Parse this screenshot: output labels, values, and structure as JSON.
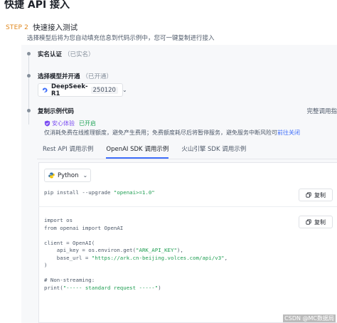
{
  "page": {
    "title": "快捷 API 接入"
  },
  "step": {
    "label": "STEP 2",
    "title": "快速接入测试",
    "desc": "选择模型后将为您自动填充信息到代码示例中，您可一键复制进行接入"
  },
  "rows": {
    "auth": {
      "label": "实名认证",
      "status": "（已实名）"
    },
    "model": {
      "label": "选择模型并开通",
      "status": "（已开通）"
    },
    "code": {
      "label": "复制示例代码"
    }
  },
  "model_select": {
    "name": "DeepSeek-R1",
    "version": "250120",
    "icon": "model-logo-icon"
  },
  "full_doc": "完整调用指",
  "safety": {
    "name": "安心体验",
    "status": "已开启",
    "notice": "仅消耗免费在线推理额度，避免产生费用；免费额度耗尽后将暂停服务，避免服务中断风险可",
    "link": "前往关闭"
  },
  "tabs": [
    {
      "label": "Rest API 调用示例"
    },
    {
      "label": "OpenAI SDK 调用示例"
    },
    {
      "label": "火山引擎 SDK 调用示例"
    }
  ],
  "lang_select": {
    "value": "Python"
  },
  "code": {
    "install": [
      "pip install --upgrade ",
      "\"openai>=1.0\""
    ],
    "l1": "import os",
    "l2": "from openai import OpenAI",
    "l3": "client = OpenAI(",
    "l4a": "    api_key = os.environ.get(",
    "l4b": "\"ARK_API_KEY\"",
    "l4c": "),",
    "l5a": "    base_url = ",
    "l5b": "\"https://ark.cn-beijing.volces.com/api/v3\"",
    "l5c": ",",
    "l6": ")",
    "l7": "# Non-streaming:",
    "l8a": "print(",
    "l8b": "\"----- standard request -----\"",
    "l8c": ")"
  },
  "copy_label": "复制",
  "watermark": "CSDN @MC数据局",
  "colors": {
    "accent": "#3d6dfa",
    "step": "#e0881f",
    "safe": "#7a4cf2",
    "on": "#23a55a",
    "string": "#1f9e52"
  }
}
